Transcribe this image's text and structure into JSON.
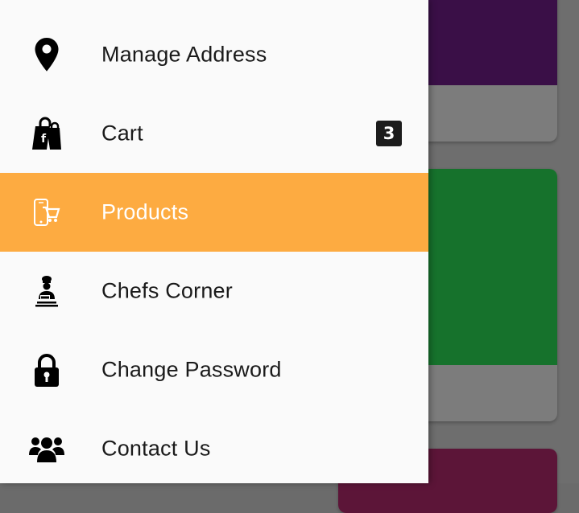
{
  "drawer": {
    "items": [
      {
        "label": "Manage Address",
        "icon": "map-pin-icon"
      },
      {
        "label": "Cart",
        "icon": "shopping-bags-icon",
        "badge": "3"
      },
      {
        "label": "Products",
        "icon": "mobile-cart-icon",
        "active": true
      },
      {
        "label": "Chefs Corner",
        "icon": "chef-icon"
      },
      {
        "label": "Change Password",
        "icon": "lock-icon"
      },
      {
        "label": "Contact Us",
        "icon": "users-icon"
      }
    ]
  },
  "colors": {
    "active_bg": "#fdab41",
    "drawer_bg": "#fafafa",
    "badge_bg": "#1c1c1c"
  }
}
